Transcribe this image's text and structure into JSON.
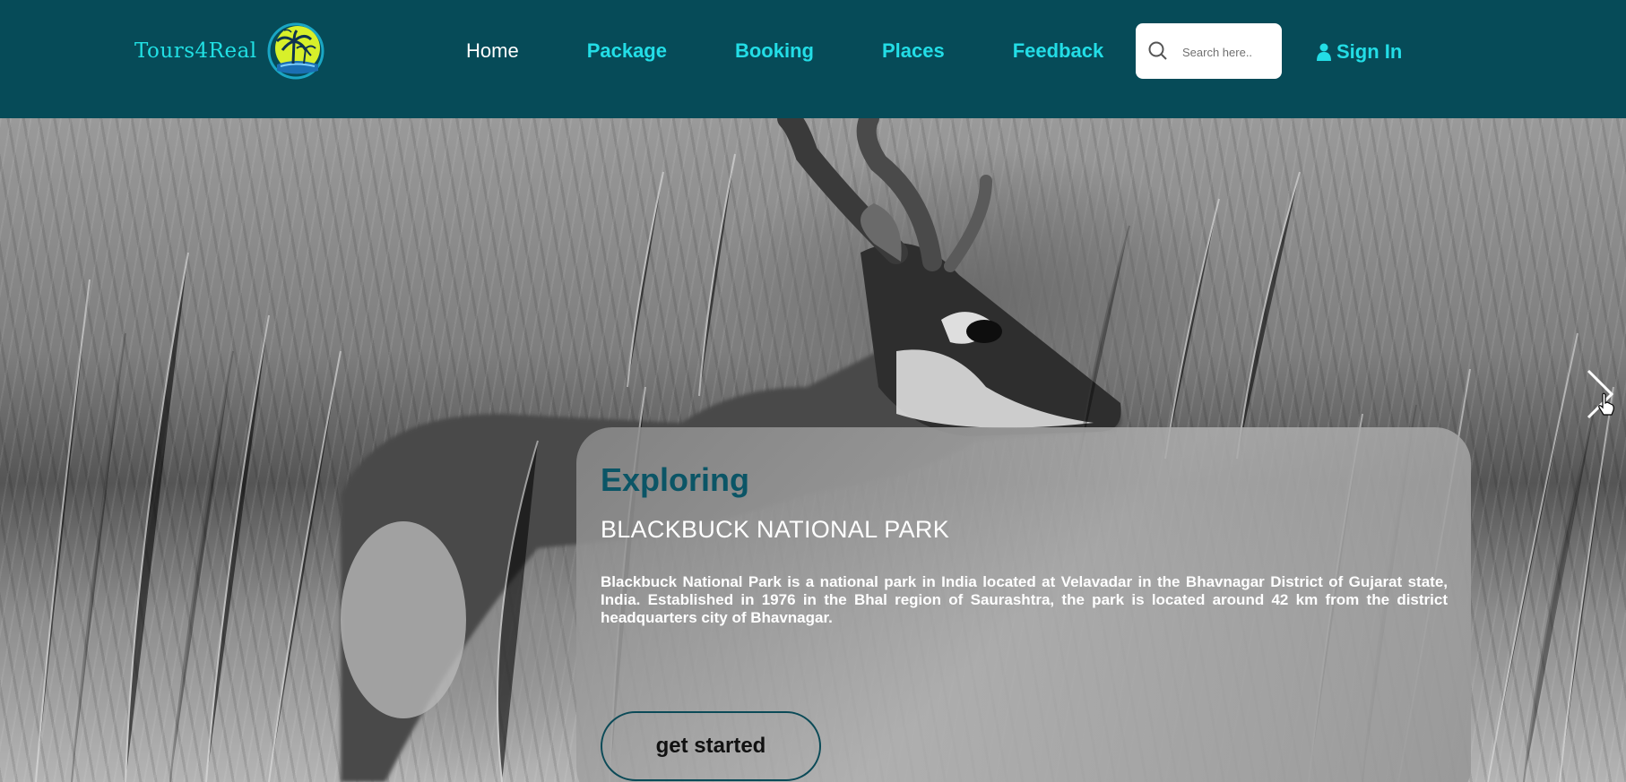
{
  "brand": {
    "name": "Tours4Real",
    "logo_icon": "palm-sun-logo-icon"
  },
  "nav": {
    "items": [
      {
        "label": "Home",
        "active": true
      },
      {
        "label": "Package",
        "active": false
      },
      {
        "label": "Booking",
        "active": false
      },
      {
        "label": "Places",
        "active": false
      },
      {
        "label": "Feedback",
        "active": false
      }
    ],
    "search": {
      "placeholder": "Search here..",
      "value": "",
      "icon": "search-icon"
    },
    "signin": {
      "label": "Sign In",
      "icon": "user-icon"
    }
  },
  "hero": {
    "kicker": "Exploring",
    "title": "BLACKBUCK NATIONAL PARK",
    "description": "Blackbuck National Park is a national park in India located at Velavadar in the Bhavnagar District of Gujarat state, India. Established in 1976 in the Bhal region of Saurashtra, the park is located around 42 km from the district headquarters city of Bhavnagar.",
    "cta_label": "get started",
    "next_icon": "chevron-right-icon"
  },
  "colors": {
    "navbar_bg": "#064b58",
    "nav_link": "#23dde6",
    "nav_active": "#ffffff",
    "kicker": "#0b5566",
    "logo_sun": "#d8f02a"
  }
}
